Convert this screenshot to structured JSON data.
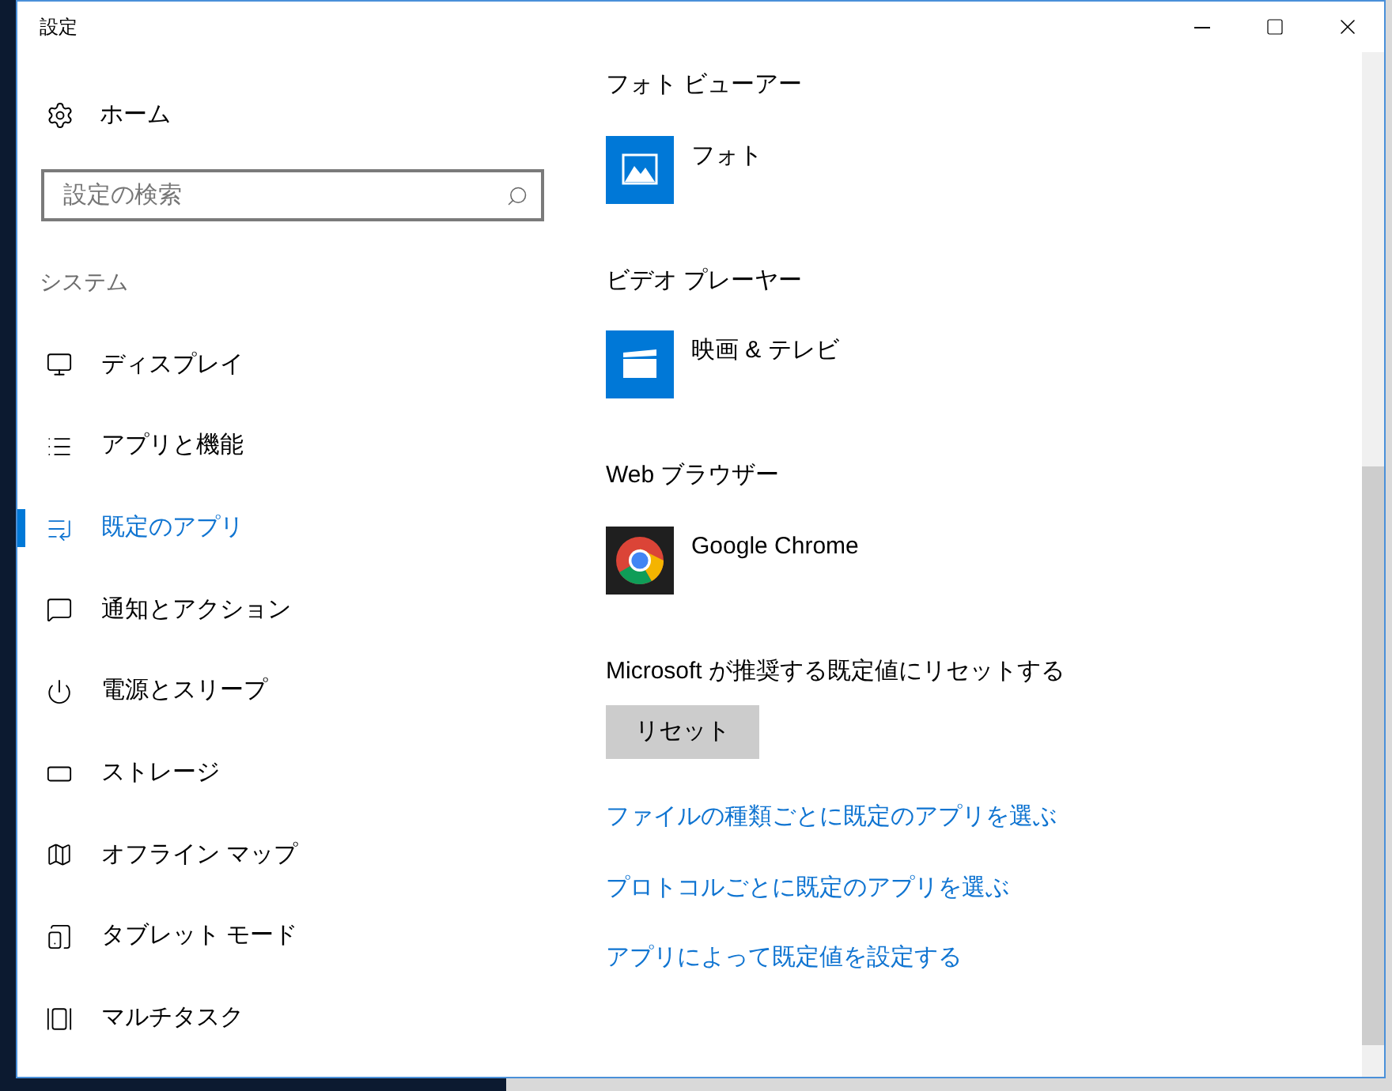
{
  "window": {
    "title": "設定"
  },
  "sidebar": {
    "home": {
      "label": "ホーム"
    },
    "search": {
      "placeholder": "設定の検索"
    },
    "section_label": "システム",
    "items": [
      {
        "label": "ディスプレイ",
        "kind": "display",
        "selected": false
      },
      {
        "label": "アプリと機能",
        "kind": "apps",
        "selected": false
      },
      {
        "label": "既定のアプリ",
        "kind": "default-apps",
        "selected": true
      },
      {
        "label": "通知とアクション",
        "kind": "notifications",
        "selected": false
      },
      {
        "label": "電源とスリープ",
        "kind": "power",
        "selected": false
      },
      {
        "label": "ストレージ",
        "kind": "storage",
        "selected": false
      },
      {
        "label": "オフライン マップ",
        "kind": "maps",
        "selected": false
      },
      {
        "label": "タブレット モード",
        "kind": "tablet",
        "selected": false
      },
      {
        "label": "マルチタスク",
        "kind": "multitask",
        "selected": false
      }
    ]
  },
  "content": {
    "groups": [
      {
        "heading": "フォト ビューアー",
        "app": {
          "name": "フォト",
          "kind": "photos"
        }
      },
      {
        "heading": "ビデオ プレーヤー",
        "app": {
          "name": "映画 & テレビ",
          "kind": "movies"
        }
      },
      {
        "heading": "Web ブラウザー",
        "app": {
          "name": "Google Chrome",
          "kind": "chrome"
        }
      }
    ],
    "reset": {
      "label": "Microsoft が推奨する既定値にリセットする",
      "button": "リセット"
    },
    "links": [
      "ファイルの種類ごとに既定のアプリを選ぶ",
      "プロトコルごとに既定のアプリを選ぶ",
      "アプリによって既定値を設定する"
    ]
  }
}
